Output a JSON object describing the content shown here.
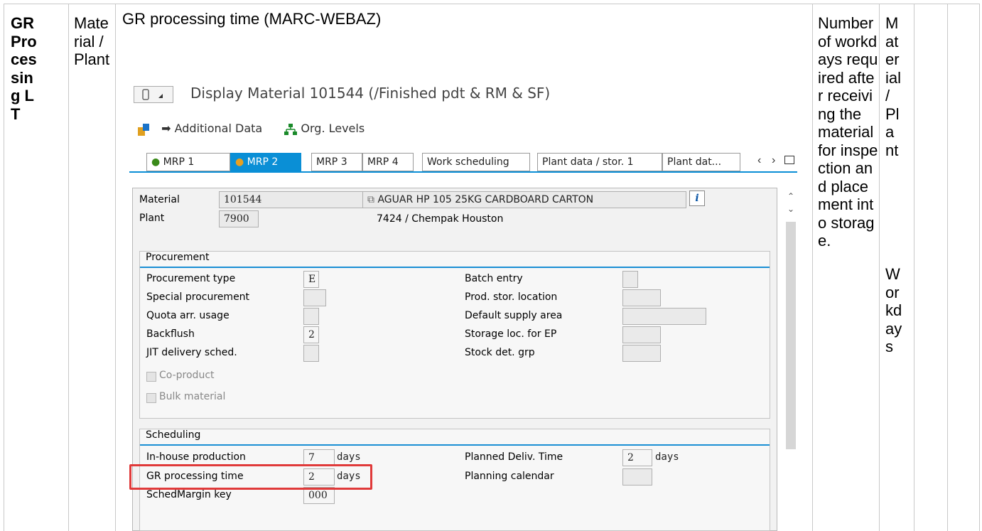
{
  "table": {
    "col1": "GR Processing LT",
    "col2": "Material / Plant",
    "col3_title": "GR processing time (MARC-WEBAZ)",
    "col4": "Number of workdays required after receiving the material for inspection and placement into storage.",
    "col5a": "Material / Plant",
    "col5b": "Workdays"
  },
  "sap": {
    "title": "Display Material 101544 (/Finished pdt & RM & SF)",
    "toolbar": {
      "additional_data": "Additional Data",
      "org_levels": "Org. Levels"
    },
    "tabs": [
      "MRP 1",
      "MRP 2",
      "MRP 3",
      "MRP 4",
      "Work scheduling",
      "Plant data / stor. 1",
      "Plant dat..."
    ],
    "active_tab": "MRP 2",
    "header": {
      "material_label": "Material",
      "material_value": "101544",
      "material_desc": "AGUAR HP 105   25KG CARDBOARD CARTON",
      "plant_label": "Plant",
      "plant_value": "7900",
      "plant_desc": "7424 / Chempak Houston"
    },
    "procurement": {
      "title": "Procurement",
      "procurement_type_label": "Procurement type",
      "procurement_type_value": "E",
      "special_procurement_label": "Special procurement",
      "quota_label": "Quota arr. usage",
      "backflush_label": "Backflush",
      "backflush_value": "2",
      "jit_label": "JIT delivery sched.",
      "batch_entry_label": "Batch entry",
      "prod_stor_label": "Prod. stor. location",
      "default_supply_label": "Default supply area",
      "storage_ep_label": "Storage loc. for EP",
      "stock_det_label": "Stock det. grp",
      "coproduct_label": "Co-product",
      "bulk_label": "Bulk material"
    },
    "scheduling": {
      "title": "Scheduling",
      "inhouse_label": "In-house production",
      "inhouse_value": "7",
      "inhouse_unit": "days",
      "gr_label": "GR processing time",
      "gr_value": "2",
      "gr_unit": "days",
      "schedmargin_label": "SchedMargin key",
      "schedmargin_value": "000",
      "planned_deliv_label": "Planned Deliv. Time",
      "planned_deliv_value": "2",
      "planned_deliv_unit": "days",
      "planning_cal_label": "Planning calendar"
    }
  }
}
